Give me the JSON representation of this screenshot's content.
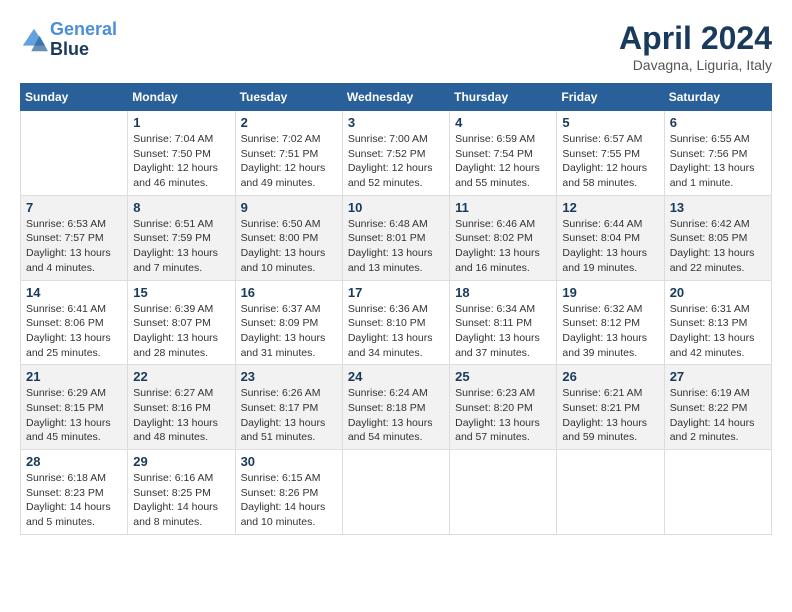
{
  "header": {
    "logo_line1": "General",
    "logo_line2": "Blue",
    "month_year": "April 2024",
    "location": "Davagna, Liguria, Italy"
  },
  "weekdays": [
    "Sunday",
    "Monday",
    "Tuesday",
    "Wednesday",
    "Thursday",
    "Friday",
    "Saturday"
  ],
  "weeks": [
    [
      {
        "day": "",
        "sunrise": "",
        "sunset": "",
        "daylight": ""
      },
      {
        "day": "1",
        "sunrise": "Sunrise: 7:04 AM",
        "sunset": "Sunset: 7:50 PM",
        "daylight": "Daylight: 12 hours and 46 minutes."
      },
      {
        "day": "2",
        "sunrise": "Sunrise: 7:02 AM",
        "sunset": "Sunset: 7:51 PM",
        "daylight": "Daylight: 12 hours and 49 minutes."
      },
      {
        "day": "3",
        "sunrise": "Sunrise: 7:00 AM",
        "sunset": "Sunset: 7:52 PM",
        "daylight": "Daylight: 12 hours and 52 minutes."
      },
      {
        "day": "4",
        "sunrise": "Sunrise: 6:59 AM",
        "sunset": "Sunset: 7:54 PM",
        "daylight": "Daylight: 12 hours and 55 minutes."
      },
      {
        "day": "5",
        "sunrise": "Sunrise: 6:57 AM",
        "sunset": "Sunset: 7:55 PM",
        "daylight": "Daylight: 12 hours and 58 minutes."
      },
      {
        "day": "6",
        "sunrise": "Sunrise: 6:55 AM",
        "sunset": "Sunset: 7:56 PM",
        "daylight": "Daylight: 13 hours and 1 minute."
      }
    ],
    [
      {
        "day": "7",
        "sunrise": "Sunrise: 6:53 AM",
        "sunset": "Sunset: 7:57 PM",
        "daylight": "Daylight: 13 hours and 4 minutes."
      },
      {
        "day": "8",
        "sunrise": "Sunrise: 6:51 AM",
        "sunset": "Sunset: 7:59 PM",
        "daylight": "Daylight: 13 hours and 7 minutes."
      },
      {
        "day": "9",
        "sunrise": "Sunrise: 6:50 AM",
        "sunset": "Sunset: 8:00 PM",
        "daylight": "Daylight: 13 hours and 10 minutes."
      },
      {
        "day": "10",
        "sunrise": "Sunrise: 6:48 AM",
        "sunset": "Sunset: 8:01 PM",
        "daylight": "Daylight: 13 hours and 13 minutes."
      },
      {
        "day": "11",
        "sunrise": "Sunrise: 6:46 AM",
        "sunset": "Sunset: 8:02 PM",
        "daylight": "Daylight: 13 hours and 16 minutes."
      },
      {
        "day": "12",
        "sunrise": "Sunrise: 6:44 AM",
        "sunset": "Sunset: 8:04 PM",
        "daylight": "Daylight: 13 hours and 19 minutes."
      },
      {
        "day": "13",
        "sunrise": "Sunrise: 6:42 AM",
        "sunset": "Sunset: 8:05 PM",
        "daylight": "Daylight: 13 hours and 22 minutes."
      }
    ],
    [
      {
        "day": "14",
        "sunrise": "Sunrise: 6:41 AM",
        "sunset": "Sunset: 8:06 PM",
        "daylight": "Daylight: 13 hours and 25 minutes."
      },
      {
        "day": "15",
        "sunrise": "Sunrise: 6:39 AM",
        "sunset": "Sunset: 8:07 PM",
        "daylight": "Daylight: 13 hours and 28 minutes."
      },
      {
        "day": "16",
        "sunrise": "Sunrise: 6:37 AM",
        "sunset": "Sunset: 8:09 PM",
        "daylight": "Daylight: 13 hours and 31 minutes."
      },
      {
        "day": "17",
        "sunrise": "Sunrise: 6:36 AM",
        "sunset": "Sunset: 8:10 PM",
        "daylight": "Daylight: 13 hours and 34 minutes."
      },
      {
        "day": "18",
        "sunrise": "Sunrise: 6:34 AM",
        "sunset": "Sunset: 8:11 PM",
        "daylight": "Daylight: 13 hours and 37 minutes."
      },
      {
        "day": "19",
        "sunrise": "Sunrise: 6:32 AM",
        "sunset": "Sunset: 8:12 PM",
        "daylight": "Daylight: 13 hours and 39 minutes."
      },
      {
        "day": "20",
        "sunrise": "Sunrise: 6:31 AM",
        "sunset": "Sunset: 8:13 PM",
        "daylight": "Daylight: 13 hours and 42 minutes."
      }
    ],
    [
      {
        "day": "21",
        "sunrise": "Sunrise: 6:29 AM",
        "sunset": "Sunset: 8:15 PM",
        "daylight": "Daylight: 13 hours and 45 minutes."
      },
      {
        "day": "22",
        "sunrise": "Sunrise: 6:27 AM",
        "sunset": "Sunset: 8:16 PM",
        "daylight": "Daylight: 13 hours and 48 minutes."
      },
      {
        "day": "23",
        "sunrise": "Sunrise: 6:26 AM",
        "sunset": "Sunset: 8:17 PM",
        "daylight": "Daylight: 13 hours and 51 minutes."
      },
      {
        "day": "24",
        "sunrise": "Sunrise: 6:24 AM",
        "sunset": "Sunset: 8:18 PM",
        "daylight": "Daylight: 13 hours and 54 minutes."
      },
      {
        "day": "25",
        "sunrise": "Sunrise: 6:23 AM",
        "sunset": "Sunset: 8:20 PM",
        "daylight": "Daylight: 13 hours and 57 minutes."
      },
      {
        "day": "26",
        "sunrise": "Sunrise: 6:21 AM",
        "sunset": "Sunset: 8:21 PM",
        "daylight": "Daylight: 13 hours and 59 minutes."
      },
      {
        "day": "27",
        "sunrise": "Sunrise: 6:19 AM",
        "sunset": "Sunset: 8:22 PM",
        "daylight": "Daylight: 14 hours and 2 minutes."
      }
    ],
    [
      {
        "day": "28",
        "sunrise": "Sunrise: 6:18 AM",
        "sunset": "Sunset: 8:23 PM",
        "daylight": "Daylight: 14 hours and 5 minutes."
      },
      {
        "day": "29",
        "sunrise": "Sunrise: 6:16 AM",
        "sunset": "Sunset: 8:25 PM",
        "daylight": "Daylight: 14 hours and 8 minutes."
      },
      {
        "day": "30",
        "sunrise": "Sunrise: 6:15 AM",
        "sunset": "Sunset: 8:26 PM",
        "daylight": "Daylight: 14 hours and 10 minutes."
      },
      {
        "day": "",
        "sunrise": "",
        "sunset": "",
        "daylight": ""
      },
      {
        "day": "",
        "sunrise": "",
        "sunset": "",
        "daylight": ""
      },
      {
        "day": "",
        "sunrise": "",
        "sunset": "",
        "daylight": ""
      },
      {
        "day": "",
        "sunrise": "",
        "sunset": "",
        "daylight": ""
      }
    ]
  ]
}
